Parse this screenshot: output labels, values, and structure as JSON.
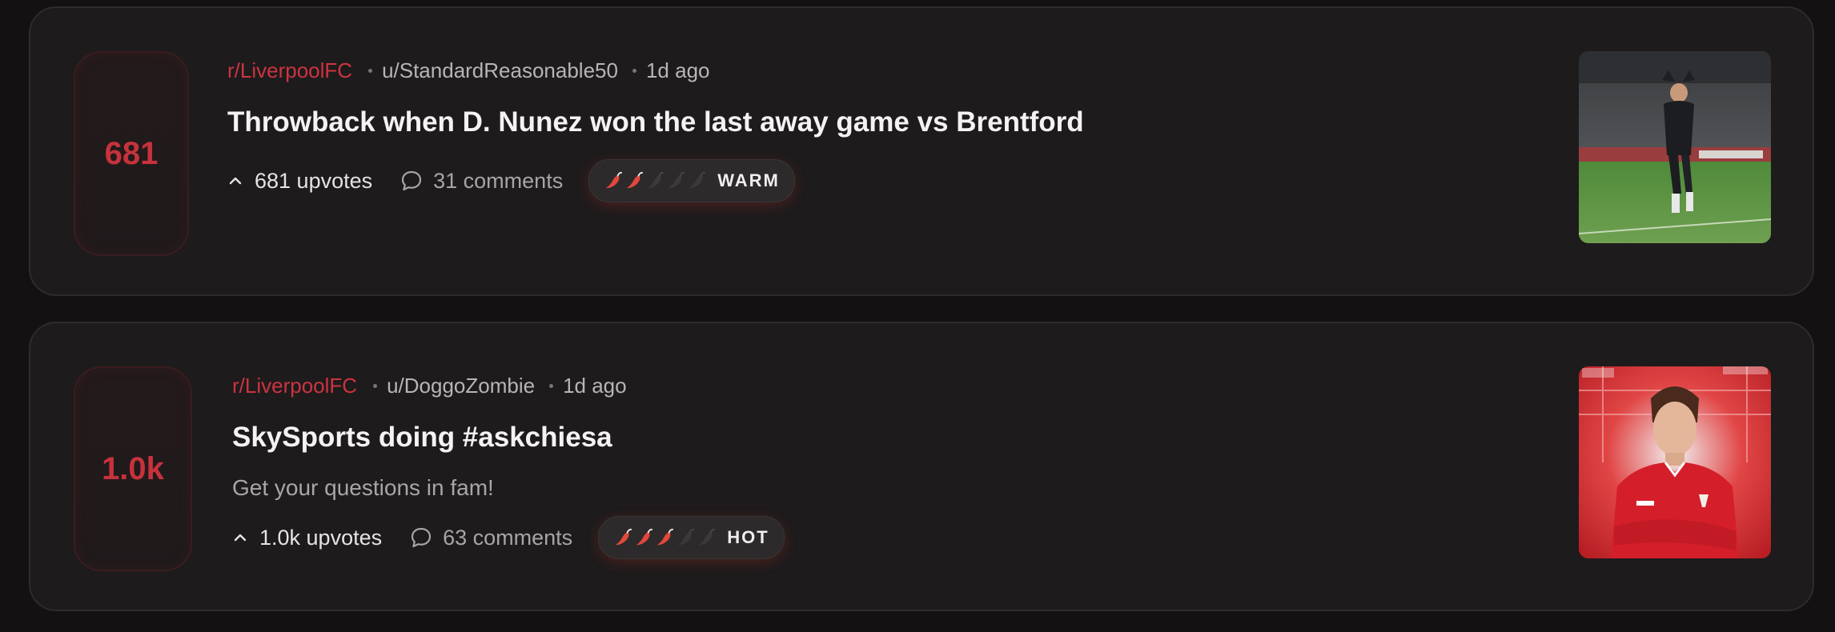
{
  "posts": [
    {
      "score": "681",
      "subreddit": "r/LiverpoolFC",
      "author": "u/StandardReasonable50",
      "age": "1d ago",
      "title": "Throwback when D. Nunez won the last away game vs Brentford",
      "body": "",
      "upvotes": "681 upvotes",
      "comments": "31 comments",
      "heat_label": "WARM",
      "heat_level": 2,
      "heat_max": 5,
      "thumbnail": "player-celebration-photo"
    },
    {
      "score": "1.0k",
      "subreddit": "r/LiverpoolFC",
      "author": "u/DoggoZombie",
      "age": "1d ago",
      "title": "SkySports doing #askchiesa",
      "body": "Get your questions in fam!",
      "upvotes": "1.0k upvotes",
      "comments": "63 comments",
      "heat_label": "HOT",
      "heat_level": 3,
      "heat_max": 5,
      "thumbnail": "player-portrait-photo"
    }
  ],
  "colors": {
    "accent": "#cc3440",
    "card": "#1e1b1c",
    "background": "#141112"
  }
}
